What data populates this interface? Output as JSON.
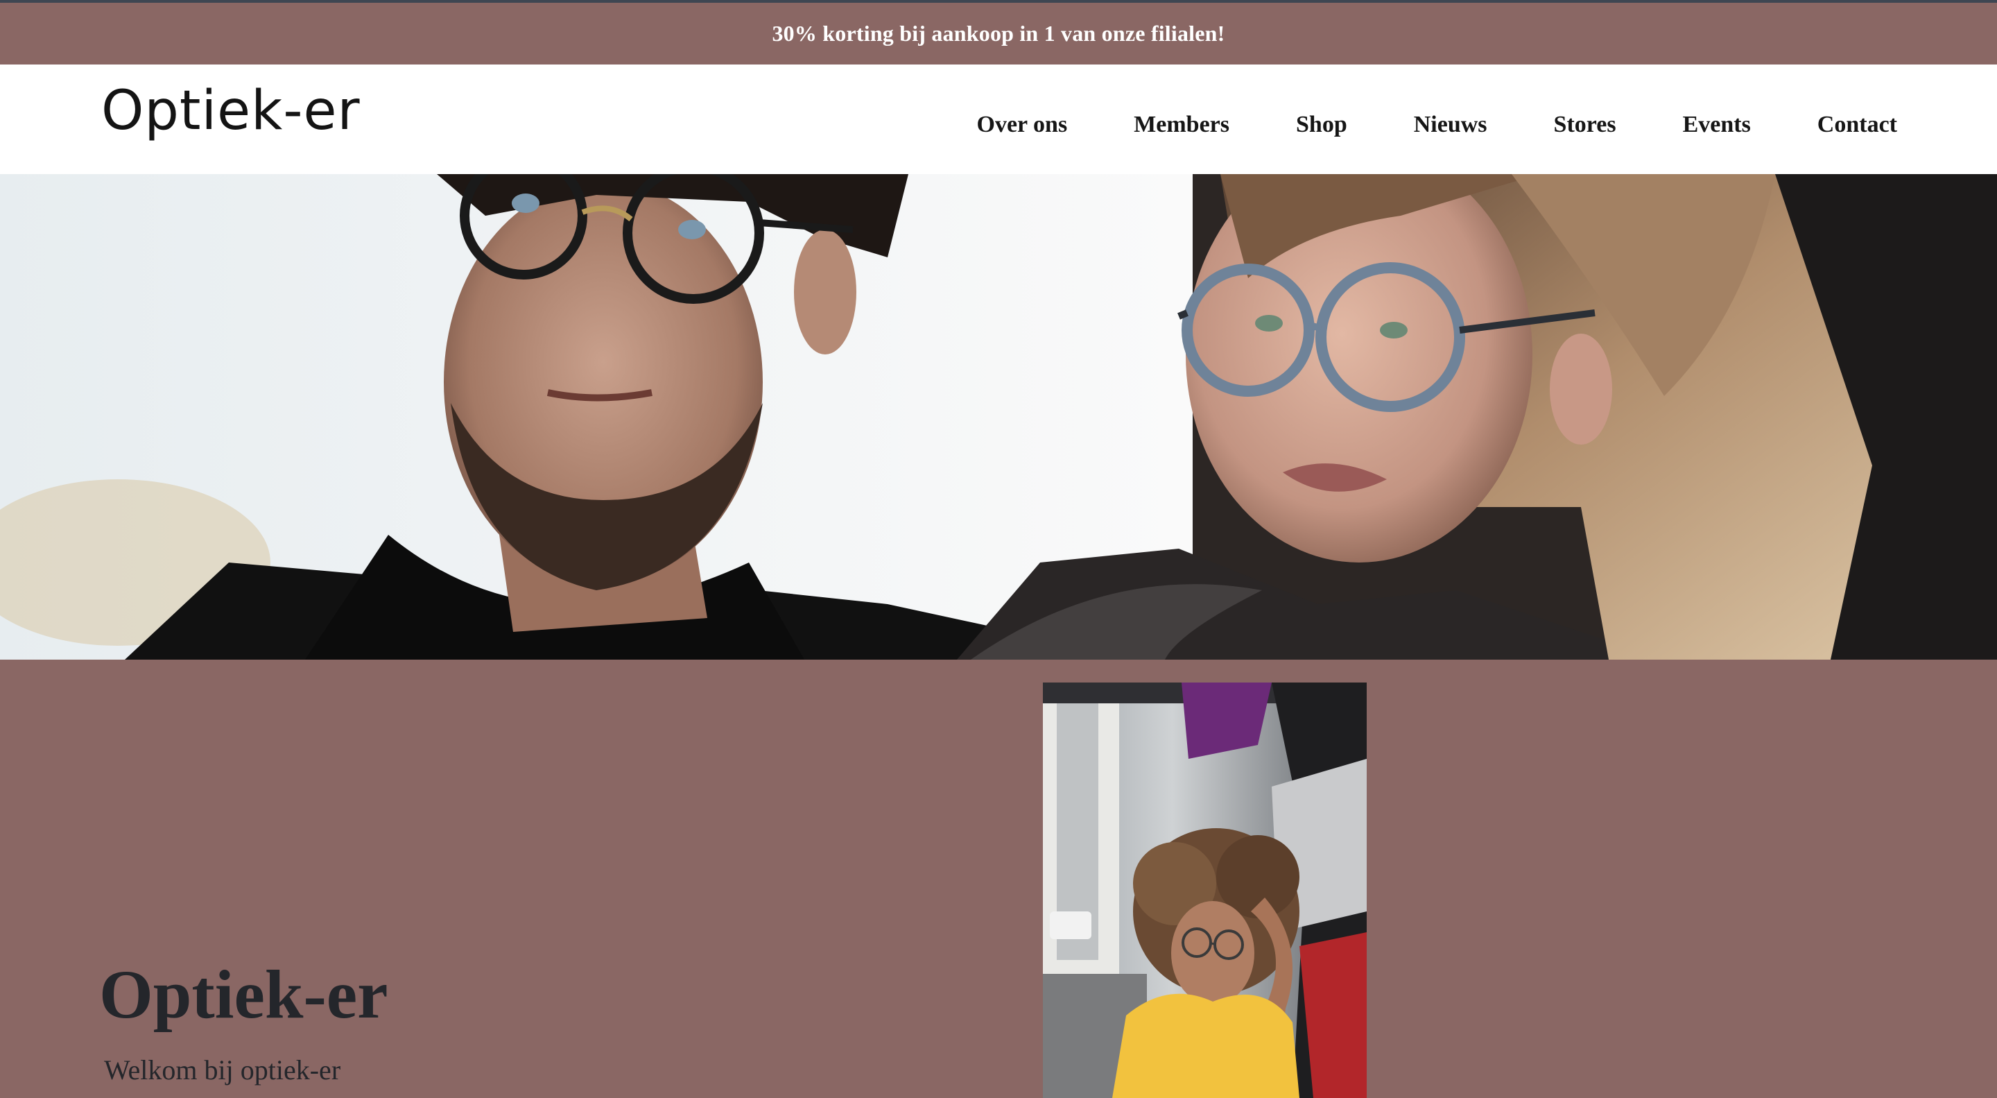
{
  "promo": {
    "text": "30% korting bij aankoop in 1 van onze filialen!"
  },
  "header": {
    "logo_text": "Optiek-er",
    "nav": [
      {
        "label": "Over ons"
      },
      {
        "label": "Members"
      },
      {
        "label": "Shop"
      },
      {
        "label": "Nieuws"
      },
      {
        "label": "Stores"
      },
      {
        "label": "Events"
      },
      {
        "label": "Contact"
      }
    ]
  },
  "hero": {
    "image": "hero-photo-man-and-woman-with-glasses"
  },
  "main": {
    "image": "portrait-woman-curly-hair-glasses-yellow-shirt",
    "title": "Optiek-er",
    "subtitle": "Welkom bij optiek-er"
  },
  "colors": {
    "brand": "#8a6764",
    "header_bg": "#ffffff",
    "text_dark": "#24262b",
    "banner_text": "#ffffff"
  }
}
